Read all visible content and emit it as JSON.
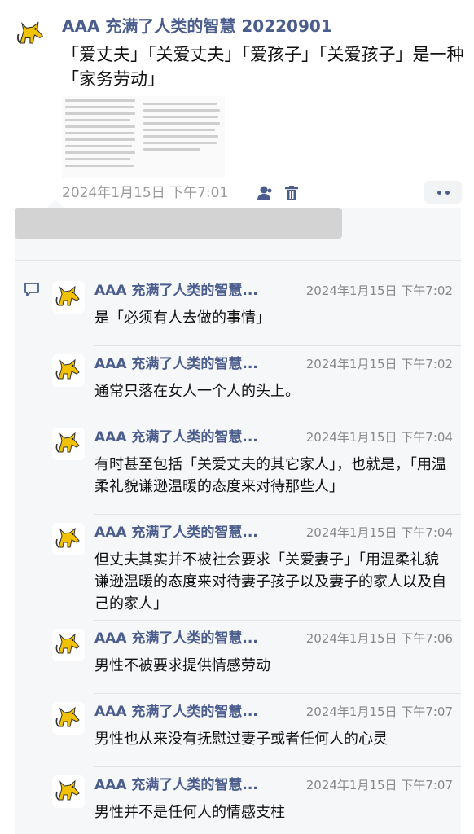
{
  "post": {
    "author": "AAA 充满了人类的智慧 20220901",
    "text": "「爱丈夫」「关爱丈夫」「爱孩子」「关爱孩子」是一种「家务劳动」",
    "time": "2024年1月15日 下午7:01",
    "icons": [
      "user-icon",
      "trash-icon",
      "more-icon"
    ]
  },
  "comments": [
    {
      "author": "AAA 充满了人类的智慧...",
      "time": "2024年1月15日 下午7:02",
      "text": "是「必须有人去做的事情」"
    },
    {
      "author": "AAA 充满了人类的智慧...",
      "time": "2024年1月15日 下午7:02",
      "text": "通常只落在女人一个人的头上。"
    },
    {
      "author": "AAA 充满了人类的智慧...",
      "time": "2024年1月15日 下午7:04",
      "text": "有时甚至包括「关爱丈夫的其它家人」，也就是，「用温柔礼貌谦逊温暖的态度来对待那些人」"
    },
    {
      "author": "AAA 充满了人类的智慧...",
      "time": "2024年1月15日 下午7:04",
      "text": "但丈夫其实并不被社会要求「关爱妻子」「用温柔礼貌谦逊温暖的态度来对待妻子孩子以及妻子的家人以及自己的家人」"
    },
    {
      "author": "AAA 充满了人类的智慧...",
      "time": "2024年1月15日 下午7:06",
      "text": "男性不被要求提供情感劳动"
    },
    {
      "author": "AAA 充满了人类的智慧...",
      "time": "2024年1月15日 下午7:07",
      "text": "男性也从来没有抚慰过妻子或者任何人的心灵"
    },
    {
      "author": "AAA 充满了人类的智慧...",
      "time": "2024年1月15日 下午7:07",
      "text": "男性并不是任何人的情感支柱"
    }
  ],
  "colors": {
    "accent": "#4a5d8c",
    "meta": "#9a9a9a",
    "panel": "#f6f7f9"
  }
}
